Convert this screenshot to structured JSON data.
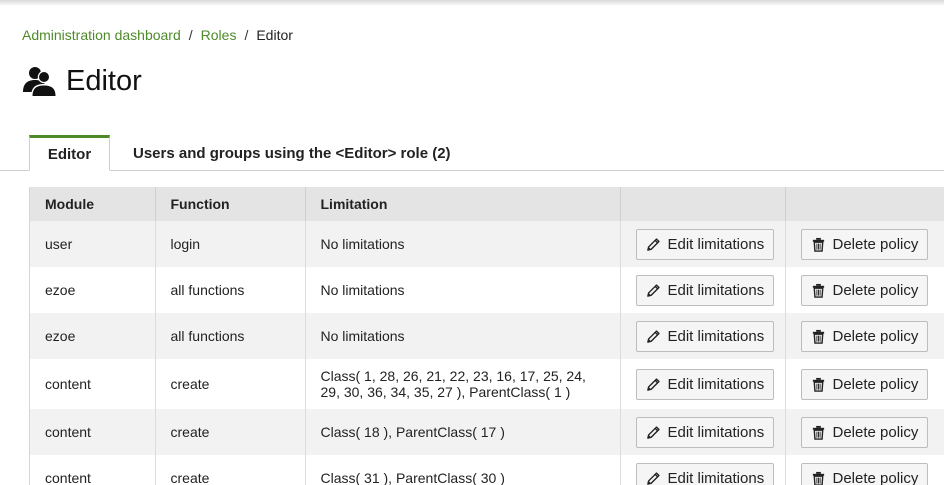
{
  "breadcrumb": {
    "items": [
      "Administration dashboard",
      "Roles"
    ],
    "separator": "/",
    "current": "Editor"
  },
  "page": {
    "title": "Editor",
    "icon": "users-icon"
  },
  "tabs": [
    {
      "label": "Editor",
      "active": true
    },
    {
      "label": "Users and groups using the <Editor> role (2)",
      "active": false
    }
  ],
  "table": {
    "headers": [
      "Module",
      "Function",
      "Limitation",
      "",
      ""
    ],
    "edit_label": "Edit limitations",
    "delete_label": "Delete policy",
    "rows": [
      {
        "module": "user",
        "function": "login",
        "limitation": "No limitations"
      },
      {
        "module": "ezoe",
        "function": "all functions",
        "limitation": "No limitations"
      },
      {
        "module": "ezoe",
        "function": "all functions",
        "limitation": "No limitations"
      },
      {
        "module": "content",
        "function": "create",
        "limitation": "Class( 1, 28, 26, 21, 22, 23, 16, 17, 25, 24, 29, 30, 36, 34, 35, 27 ), ParentClass( 1 )"
      },
      {
        "module": "content",
        "function": "create",
        "limitation": "Class( 18 ), ParentClass( 17 )"
      },
      {
        "module": "content",
        "function": "create",
        "limitation": "Class( 31 ), ParentClass( 30 )"
      }
    ]
  },
  "colors": {
    "accent": "#4e8a2a",
    "header_bg": "#e4e4e4",
    "row_alt": "#f2f2f2"
  }
}
